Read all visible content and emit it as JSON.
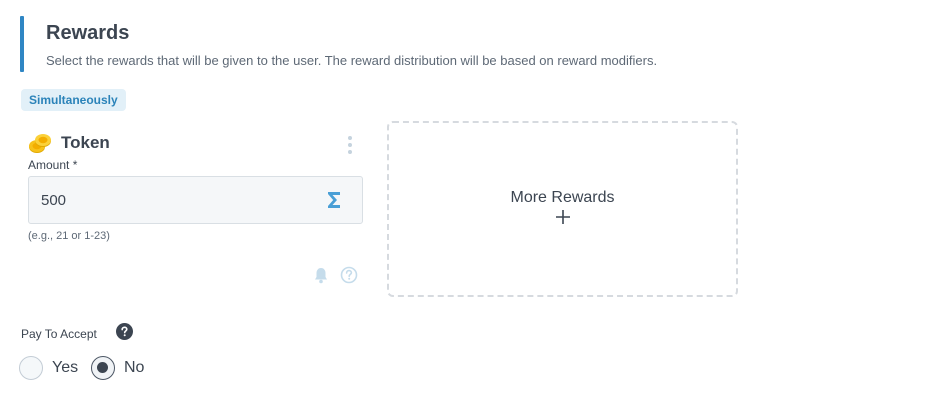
{
  "section": {
    "title": "Rewards",
    "description": "Select the rewards that will be given to the user. The reward distribution will be based on reward modifiers."
  },
  "badge": "Simultaneously",
  "reward": {
    "icon": "coins-icon",
    "name": "Token",
    "amount_label": "Amount *",
    "amount_value": "500",
    "amount_hint": "(e.g., 21 or 1-23)"
  },
  "more_rewards": {
    "label": "More Rewards",
    "icon": "plus-icon"
  },
  "pay_to_accept": {
    "label": "Pay To Accept",
    "options": [
      {
        "label": "Yes",
        "selected": false
      },
      {
        "label": "No",
        "selected": true
      }
    ]
  },
  "colors": {
    "accent": "#2f86c4",
    "badge_bg": "#e2f0f8",
    "badge_text": "#2b83b9",
    "text": "#3c4551",
    "icon_muted": "#c5d3de"
  }
}
